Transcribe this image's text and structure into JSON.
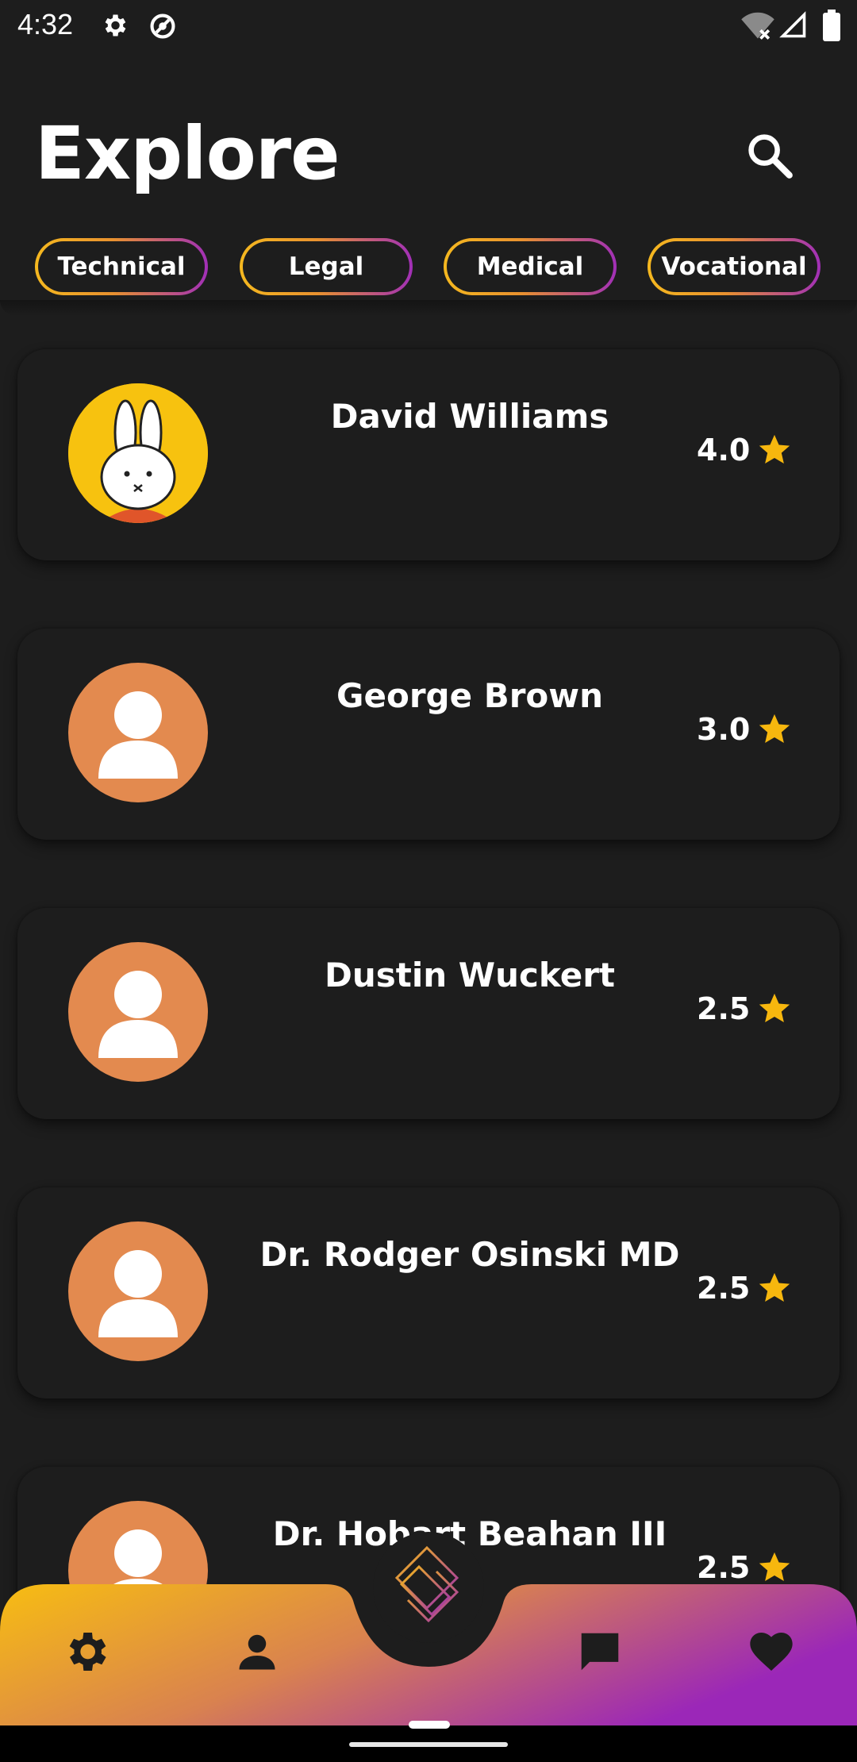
{
  "status_bar": {
    "time": "4:32"
  },
  "header": {
    "title": "Explore"
  },
  "categories": [
    "Technical",
    "Legal",
    "Medical",
    "Vocational"
  ],
  "people": [
    {
      "name": "David Williams",
      "rating": "4.0",
      "avatar": "miffy-avatar"
    },
    {
      "name": "George Brown",
      "rating": "3.0",
      "avatar": "person-placeholder"
    },
    {
      "name": "Dustin Wuckert",
      "rating": "2.5",
      "avatar": "person-placeholder"
    },
    {
      "name": "Dr. Rodger Osinski MD",
      "rating": "2.5",
      "avatar": "person-placeholder"
    },
    {
      "name": "Dr. Hobart Beahan III",
      "rating": "2.5",
      "avatar": "person-placeholder"
    }
  ],
  "colors": {
    "background": "#1d1d1d",
    "avatar_placeholder": "#e38a4f",
    "star": "#f7b70e",
    "nav_gradient_start": "#f7bd12",
    "nav_gradient_mid": "#d9824f",
    "nav_gradient_end": "#9b27b8"
  },
  "bottom_nav": {
    "items": [
      "settings-icon",
      "person-icon",
      "chat-icon",
      "heart-icon"
    ],
    "center": "app-logo-icon"
  }
}
